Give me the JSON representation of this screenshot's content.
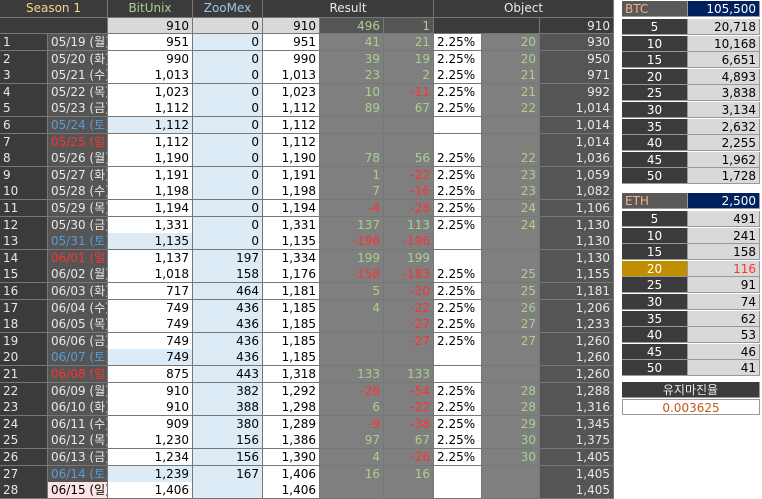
{
  "colors": {
    "dark": "#3b3b3b",
    "green": "#a9d18e",
    "red": "#ff3131",
    "blue_day": "#4472c4",
    "sat_fill": "#ddebf7",
    "sun_fill": "#fce4e4",
    "header_blue": "#002060",
    "highlight": "#bf8f00"
  },
  "header": {
    "season": "Season 1",
    "bitunix": "BitUnix",
    "zoomex": "ZooMex",
    "result": "Result",
    "object": "Object"
  },
  "totals": {
    "bitunix": "910",
    "zoomex": "0",
    "sum": "910",
    "diff": "496",
    "daily": "1",
    "object": "910"
  },
  "rows": [
    {
      "n": "1",
      "date": "05/19 (월)",
      "day": "w",
      "bitunix": "951",
      "zoomex": "0",
      "sum": "951",
      "diff": "41",
      "daily": "21",
      "pct": "2.25%",
      "obj": "20",
      "target": "930"
    },
    {
      "n": "2",
      "date": "05/20 (화)",
      "day": "w",
      "bitunix": "990",
      "zoomex": "0",
      "sum": "990",
      "diff": "39",
      "daily": "19",
      "pct": "2.25%",
      "obj": "20",
      "target": "950"
    },
    {
      "n": "3",
      "date": "05/21 (수)",
      "day": "w",
      "bitunix": "1,013",
      "zoomex": "0",
      "sum": "1,013",
      "diff": "23",
      "daily": "2",
      "pct": "2.25%",
      "obj": "21",
      "target": "971"
    },
    {
      "n": "4",
      "date": "05/22 (목)",
      "day": "w",
      "bitunix": "1,023",
      "zoomex": "0",
      "sum": "1,023",
      "diff": "10",
      "daily": "-11",
      "pct": "2.25%",
      "obj": "21",
      "target": "992"
    },
    {
      "n": "5",
      "date": "05/23 (금)",
      "day": "w",
      "bitunix": "1,112",
      "zoomex": "0",
      "sum": "1,112",
      "diff": "89",
      "daily": "67",
      "pct": "2.25%",
      "obj": "22",
      "target": "1,014"
    },
    {
      "n": "6",
      "date": "05/24 (토)",
      "day": "sat",
      "bitunix": "1,112",
      "zoomex": "0",
      "sum": "1,112",
      "diff": "",
      "daily": "",
      "pct": "",
      "obj": "",
      "target": "1,014"
    },
    {
      "n": "7",
      "date": "05/25 (일)",
      "day": "sun",
      "bitunix": "1,112",
      "zoomex": "0",
      "sum": "1,112",
      "diff": "",
      "daily": "",
      "pct": "",
      "obj": "",
      "target": "1,014"
    },
    {
      "n": "8",
      "date": "05/26 (월)",
      "day": "w",
      "bitunix": "1,190",
      "zoomex": "0",
      "sum": "1,190",
      "diff": "78",
      "daily": "56",
      "pct": "2.25%",
      "obj": "22",
      "target": "1,036"
    },
    {
      "n": "9",
      "date": "05/27 (화)",
      "day": "w",
      "bitunix": "1,191",
      "zoomex": "0",
      "sum": "1,191",
      "diff": "1",
      "daily": "-22",
      "pct": "2.25%",
      "obj": "23",
      "target": "1,059"
    },
    {
      "n": "10",
      "date": "05/28 (수)",
      "day": "w",
      "bitunix": "1,198",
      "zoomex": "0",
      "sum": "1,198",
      "diff": "7",
      "daily": "-16",
      "pct": "2.25%",
      "obj": "23",
      "target": "1,082"
    },
    {
      "n": "11",
      "date": "05/29 (목)",
      "day": "w",
      "bitunix": "1,194",
      "zoomex": "0",
      "sum": "1,194",
      "diff": "-4",
      "daily": "-28",
      "pct": "2.25%",
      "obj": "24",
      "target": "1,106"
    },
    {
      "n": "12",
      "date": "05/30 (금)",
      "day": "w",
      "bitunix": "1,331",
      "zoomex": "0",
      "sum": "1,331",
      "diff": "137",
      "daily": "113",
      "pct": "2.25%",
      "obj": "24",
      "target": "1,130"
    },
    {
      "n": "13",
      "date": "05/31 (토)",
      "day": "sat",
      "bitunix": "1,135",
      "zoomex": "0",
      "sum": "1,135",
      "diff": "-196",
      "daily": "-196",
      "pct": "",
      "obj": "",
      "target": "1,130"
    },
    {
      "n": "14",
      "date": "06/01 (일)",
      "day": "sun",
      "bitunix": "1,137",
      "zoomex": "197",
      "sum": "1,334",
      "diff": "199",
      "daily": "199",
      "pct": "",
      "obj": "",
      "target": "1,130"
    },
    {
      "n": "15",
      "date": "06/02 (월)",
      "day": "w",
      "bitunix": "1,018",
      "zoomex": "158",
      "sum": "1,176",
      "diff": "-158",
      "daily": "-183",
      "pct": "2.25%",
      "obj": "25",
      "target": "1,155"
    },
    {
      "n": "16",
      "date": "06/03 (화)",
      "day": "w",
      "bitunix": "717",
      "zoomex": "464",
      "sum": "1,181",
      "diff": "5",
      "daily": "-20",
      "pct": "2.25%",
      "obj": "25",
      "target": "1,181"
    },
    {
      "n": "17",
      "date": "06/04 (수)",
      "day": "w",
      "bitunix": "749",
      "zoomex": "436",
      "sum": "1,185",
      "diff": "4",
      "daily": "-22",
      "pct": "2.25%",
      "obj": "26",
      "target": "1,206"
    },
    {
      "n": "18",
      "date": "06/05 (목)",
      "day": "w",
      "bitunix": "749",
      "zoomex": "436",
      "sum": "1,185",
      "diff": "",
      "daily": "-27",
      "pct": "2.25%",
      "obj": "27",
      "target": "1,233"
    },
    {
      "n": "19",
      "date": "06/06 (금)",
      "day": "w",
      "bitunix": "749",
      "zoomex": "436",
      "sum": "1,185",
      "diff": "",
      "daily": "-27",
      "pct": "2.25%",
      "obj": "27",
      "target": "1,260"
    },
    {
      "n": "20",
      "date": "06/07 (토)",
      "day": "sat",
      "bitunix": "749",
      "zoomex": "436",
      "sum": "1,185",
      "diff": "",
      "daily": "",
      "pct": "",
      "obj": "",
      "target": "1,260"
    },
    {
      "n": "21",
      "date": "06/08 (일)",
      "day": "sun",
      "bitunix": "875",
      "zoomex": "443",
      "sum": "1,318",
      "diff": "133",
      "daily": "133",
      "pct": "",
      "obj": "",
      "target": "1,260"
    },
    {
      "n": "22",
      "date": "06/09 (월)",
      "day": "w",
      "bitunix": "910",
      "zoomex": "382",
      "sum": "1,292",
      "diff": "-26",
      "daily": "-54",
      "pct": "2.25%",
      "obj": "28",
      "target": "1,288"
    },
    {
      "n": "23",
      "date": "06/10 (화)",
      "day": "w",
      "bitunix": "910",
      "zoomex": "388",
      "sum": "1,298",
      "diff": "6",
      "daily": "-22",
      "pct": "2.25%",
      "obj": "28",
      "target": "1,316"
    },
    {
      "n": "24",
      "date": "06/11 (수)",
      "day": "w",
      "bitunix": "909",
      "zoomex": "380",
      "sum": "1,289",
      "diff": "-9",
      "daily": "-38",
      "pct": "2.25%",
      "obj": "29",
      "target": "1,345"
    },
    {
      "n": "25",
      "date": "06/12 (목)",
      "day": "w",
      "bitunix": "1,230",
      "zoomex": "156",
      "sum": "1,386",
      "diff": "97",
      "daily": "67",
      "pct": "2.25%",
      "obj": "30",
      "target": "1,375"
    },
    {
      "n": "26",
      "date": "06/13 (금)",
      "day": "w",
      "bitunix": "1,234",
      "zoomex": "156",
      "sum": "1,390",
      "diff": "4",
      "daily": "-26",
      "pct": "2.25%",
      "obj": "30",
      "target": "1,405"
    },
    {
      "n": "27",
      "date": "06/14 (토)",
      "day": "sat",
      "bitunix": "1,239",
      "zoomex": "167",
      "sum": "1,406",
      "diff": "16",
      "daily": "16",
      "pct": "",
      "obj": "",
      "target": "1,405"
    },
    {
      "n": "28",
      "date": "06/15 (일)",
      "day": "sun",
      "bitunix": "1,406",
      "zoomex": "",
      "sum": "1,406",
      "diff": "",
      "daily": "",
      "pct": "",
      "obj": "",
      "target": "1,405"
    }
  ],
  "btc": {
    "label": "BTC",
    "price": "105,500",
    "rows": [
      [
        "5",
        "20,718"
      ],
      [
        "10",
        "10,168"
      ],
      [
        "15",
        "6,651"
      ],
      [
        "20",
        "4,893"
      ],
      [
        "25",
        "3,838"
      ],
      [
        "30",
        "3,134"
      ],
      [
        "35",
        "2,632"
      ],
      [
        "40",
        "2,255"
      ],
      [
        "45",
        "1,962"
      ],
      [
        "50",
        "1,728"
      ]
    ]
  },
  "eth": {
    "label": "ETH",
    "price": "2,500",
    "highlight_index": 3,
    "rows": [
      [
        "5",
        "491"
      ],
      [
        "10",
        "241"
      ],
      [
        "15",
        "158"
      ],
      [
        "20",
        "116"
      ],
      [
        "25",
        "91"
      ],
      [
        "30",
        "74"
      ],
      [
        "35",
        "62"
      ],
      [
        "40",
        "53"
      ],
      [
        "45",
        "46"
      ],
      [
        "50",
        "41"
      ]
    ]
  },
  "margin": {
    "label": "유지마진율",
    "value": "0.003625"
  }
}
